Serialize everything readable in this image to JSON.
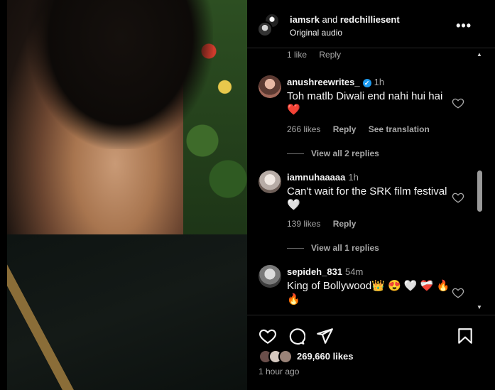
{
  "header": {
    "user1": "iamsrk",
    "and": "and",
    "user2": "redchilliesent",
    "audio": "Original audio",
    "more": "•••"
  },
  "comments": {
    "prev_meta": {
      "likes": "1 like",
      "reply": "Reply"
    },
    "items": [
      {
        "username": "anushreewrites_",
        "verified": true,
        "time": "1h",
        "text": "Toh matlb Diwali end nahi hui hai ❤️",
        "likes": "266 likes",
        "reply": "Reply",
        "translate": "See translation",
        "view_replies": "View all 2 replies",
        "avatar_color": "#b86c5a"
      },
      {
        "username": "iamnuhaaaaa",
        "verified": false,
        "time": "1h",
        "text": "Can't wait for the SRK film festival 🤍",
        "likes": "139 likes",
        "reply": "Reply",
        "view_replies": "View all 1 replies",
        "avatar_color": "#c9c3c0"
      },
      {
        "username": "sepideh_831",
        "verified": false,
        "time": "54m",
        "text": "King of Bollywood👑 😍 🤍 ❤️‍🩹 🔥🔥",
        "avatar_color": "#8f8f8f"
      }
    ]
  },
  "actions": {
    "icons": [
      "heart-icon",
      "comment-icon",
      "share-icon",
      "bookmark-icon"
    ],
    "likes": "269,660 likes",
    "time_ago": "1 hour ago",
    "liker_colors": [
      "#6a4e4a",
      "#d6c9c0",
      "#9a8378"
    ]
  },
  "colors": {
    "background": "#000000",
    "text": "#f5f5f5",
    "muted": "#a8a8a8",
    "verified": "#1d9bf0",
    "red_heart": "#ff3040"
  }
}
